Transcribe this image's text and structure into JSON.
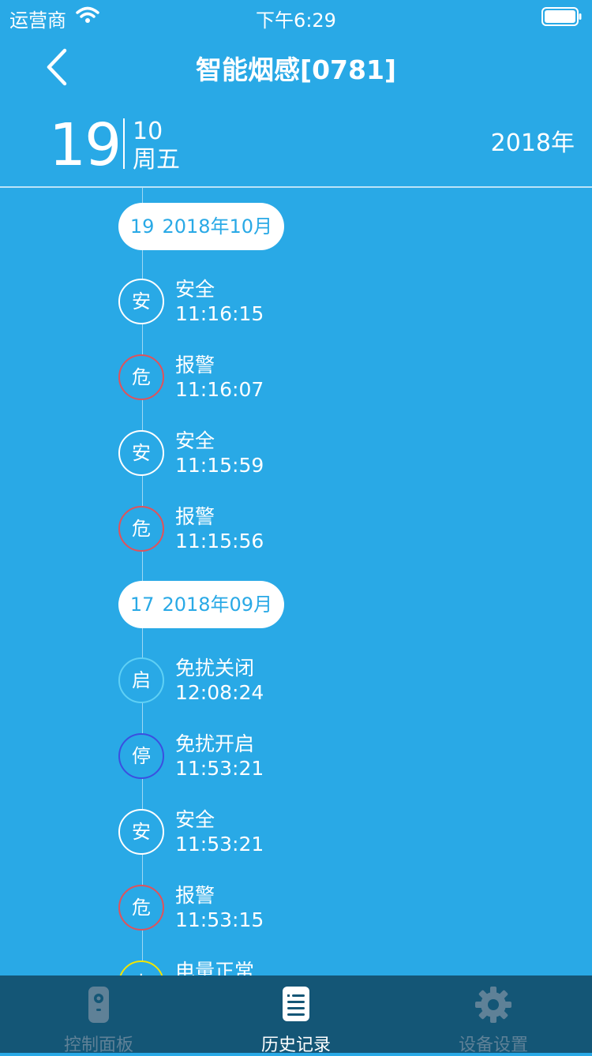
{
  "status_bar": {
    "carrier": "运营商",
    "time": "下午6:29"
  },
  "nav": {
    "title": "智能烟感[0781]",
    "back_icon": "chevron-left-icon"
  },
  "date_header": {
    "day": "19",
    "month": "10",
    "weekday": "周五",
    "year": "2018年"
  },
  "timeline": {
    "groups": [
      {
        "day": "19",
        "month_label": "2018年10月",
        "events": [
          {
            "icon_char": "安",
            "title": "安全",
            "time": "11:16:15",
            "ring_color": "#ffffff"
          },
          {
            "icon_char": "危",
            "title": "报警",
            "time": "11:16:07",
            "ring_color": "#e0525b"
          },
          {
            "icon_char": "安",
            "title": "安全",
            "time": "11:15:59",
            "ring_color": "#ffffff"
          },
          {
            "icon_char": "危",
            "title": "报警",
            "time": "11:15:56",
            "ring_color": "#e0525b"
          }
        ]
      },
      {
        "day": "17",
        "month_label": "2018年09月",
        "events": [
          {
            "icon_char": "启",
            "title": "免扰关闭",
            "time": "12:08:24",
            "ring_color": "#5fd0f5"
          },
          {
            "icon_char": "停",
            "title": "免扰开启",
            "time": "11:53:21",
            "ring_color": "#3b4fe0"
          },
          {
            "icon_char": "安",
            "title": "安全",
            "time": "11:53:21",
            "ring_color": "#ffffff"
          },
          {
            "icon_char": "危",
            "title": "报警",
            "time": "11:53:15",
            "ring_color": "#e0525b"
          },
          {
            "icon_char": "电",
            "title": "电量正常",
            "time": "",
            "ring_color": "#f2e600"
          }
        ]
      }
    ]
  },
  "tab_bar": {
    "tabs": [
      {
        "label": "控制面板",
        "icon": "remote-control-icon",
        "active": false
      },
      {
        "label": "历史记录",
        "icon": "document-list-icon",
        "active": true
      },
      {
        "label": "设备设置",
        "icon": "gear-icon",
        "active": false
      }
    ]
  },
  "colors": {
    "background": "#29a9e6",
    "tab_bar": "#145676",
    "alarm_red": "#e0525b",
    "active_tab": "#ffffff",
    "inactive_tab": "#5f8197"
  }
}
